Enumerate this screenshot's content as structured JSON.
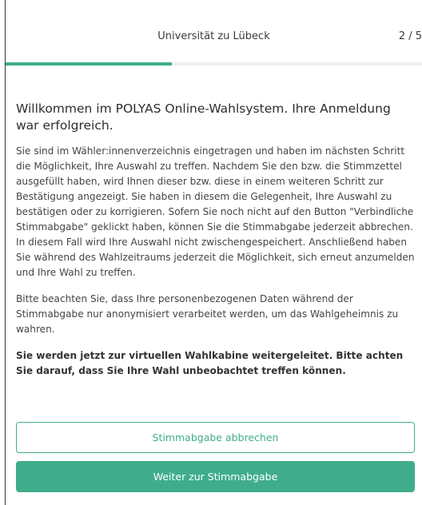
{
  "header": {
    "title": "Universität zu Lübeck",
    "step_counter": "2 / 5",
    "progress_fraction": 0.4
  },
  "main": {
    "heading": "Willkommen im POLYAS Online-Wahlsystem. Ihre Anmeldung war erfolgreich.",
    "paragraph_1": "Sie sind im Wähler:innenverzeichnis eingetragen und haben im nächsten Schritt die Möglichkeit, Ihre Auswahl zu treffen. Nachdem Sie den bzw. die Stimmzettel ausgefüllt haben, wird Ihnen dieser bzw. diese in einem weiteren Schritt zur Bestätigung angezeigt. Sie haben in diesem die Gelegenheit, Ihre Auswahl zu bestätigen oder zu korrigieren. Sofern Sie noch nicht auf den Button \"Verbindliche Stimmabgabe\" geklickt haben, können Sie die Stimmabgabe jederzeit abbrechen. In diesem Fall wird Ihre Auswahl nicht zwischengespeichert. Anschließend haben Sie während des Wahlzeitraums jederzeit die Möglichkeit, sich erneut anzumelden und Ihre Wahl zu treffen.",
    "paragraph_2": "Bitte beachten Sie, dass Ihre personenbezogenen Daten während der Stimmabgabe nur anonymisiert verarbeitet werden, um das Wahlgeheimnis zu wahren.",
    "paragraph_3": "Sie werden jetzt zur virtuellen Wahlkabine weitergeleitet. Bitte achten Sie darauf, dass Sie Ihre Wahl unbeobachtet treffen können."
  },
  "actions": {
    "cancel_label": "Stimmabgabe abbrechen",
    "continue_label": "Weiter zur Stimmabgabe"
  },
  "colors": {
    "accent": "#3fad8c",
    "text": "#3a3a3a",
    "track": "#eeeeee"
  }
}
